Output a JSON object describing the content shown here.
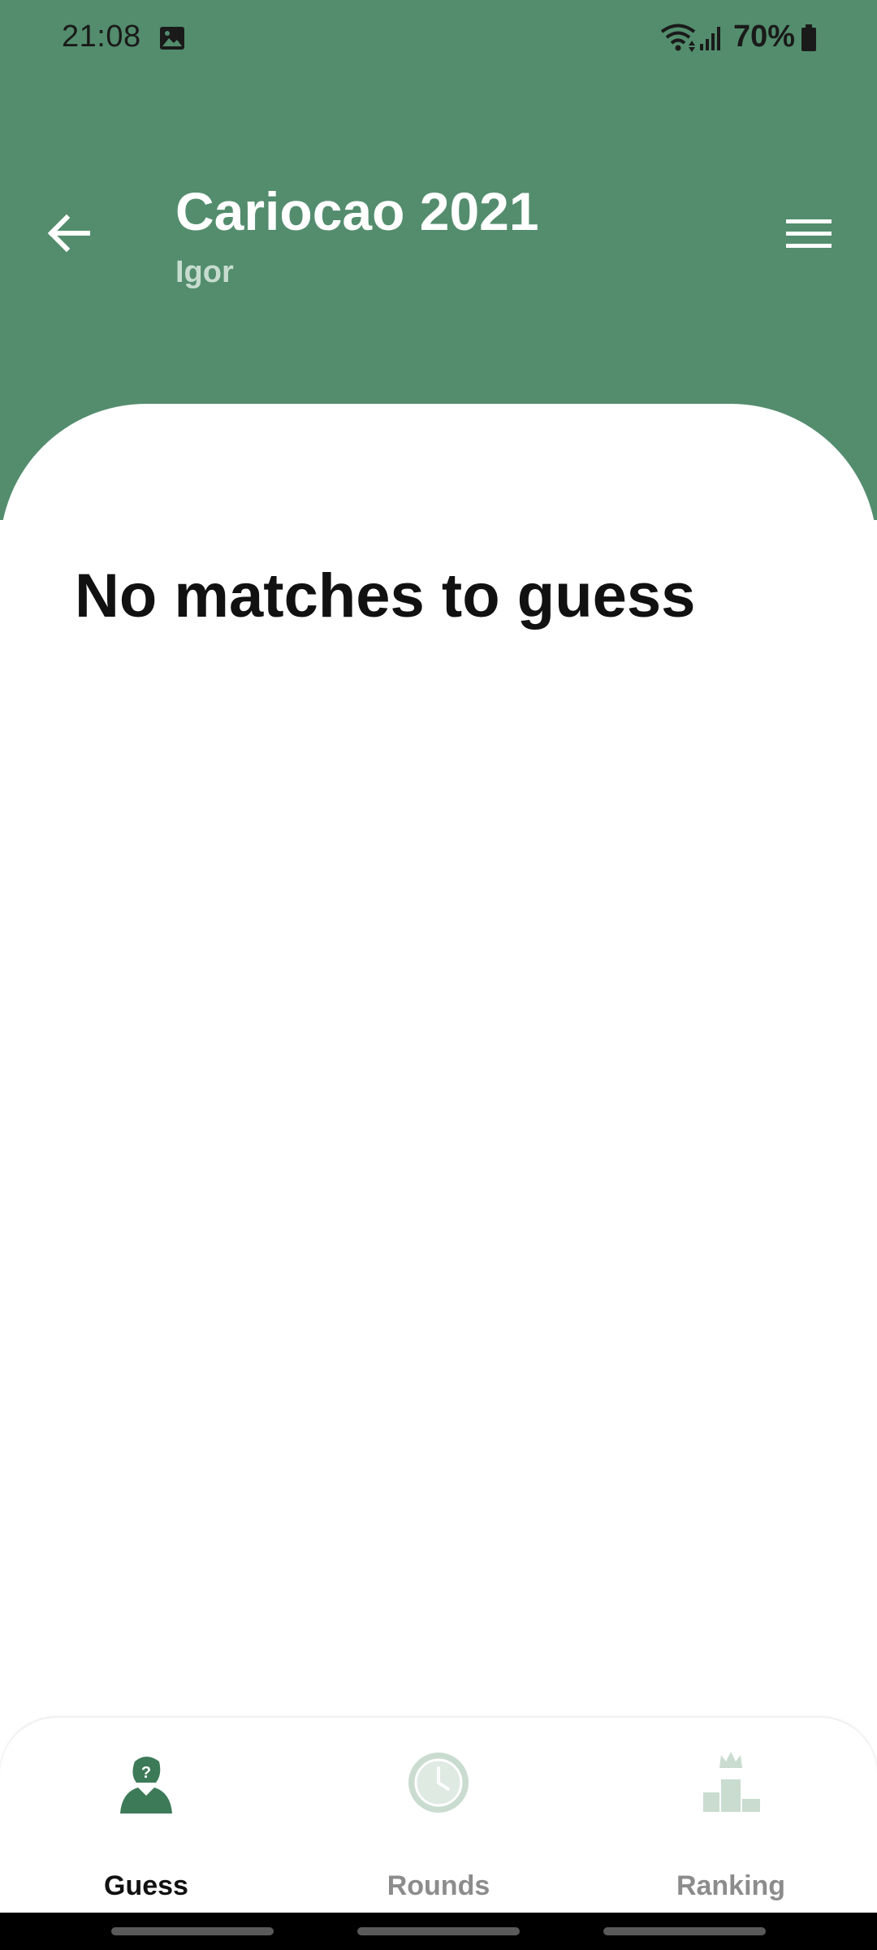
{
  "status_bar": {
    "time": "21:08",
    "battery": "70%"
  },
  "header": {
    "title": "Cariocao 2021",
    "subtitle": "Igor",
    "background_color": "#538d6d"
  },
  "main": {
    "empty_message": "No matches to guess"
  },
  "bottom_nav": {
    "items": [
      {
        "label": "Guess",
        "icon": "guess-icon",
        "active": true
      },
      {
        "label": "Rounds",
        "icon": "clock-icon",
        "active": false
      },
      {
        "label": "Ranking",
        "icon": "podium-crown-icon",
        "active": false
      }
    ],
    "active_icon_color": "#3d7a58",
    "inactive_icon_color": "#c9dccf"
  }
}
